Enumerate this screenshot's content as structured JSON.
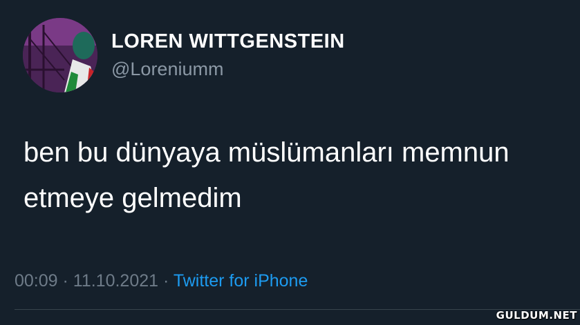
{
  "author": {
    "display_name": "LOREN WITTGENSTEIN",
    "handle": "@Loreniumm",
    "avatar_icon": "profile-avatar-icon"
  },
  "tweet": {
    "text": "ben bu dünyaya müslümanları memnun\netmeye gelmedim"
  },
  "meta": {
    "time": "00:09",
    "separator": " · ",
    "date": "11.10.2021",
    "source": "Twitter for iPhone"
  },
  "watermark": "GULDUM.NET",
  "colors": {
    "background": "#15202b",
    "text": "#ffffff",
    "muted": "#8b98a5",
    "link": "#1d9bf0"
  }
}
